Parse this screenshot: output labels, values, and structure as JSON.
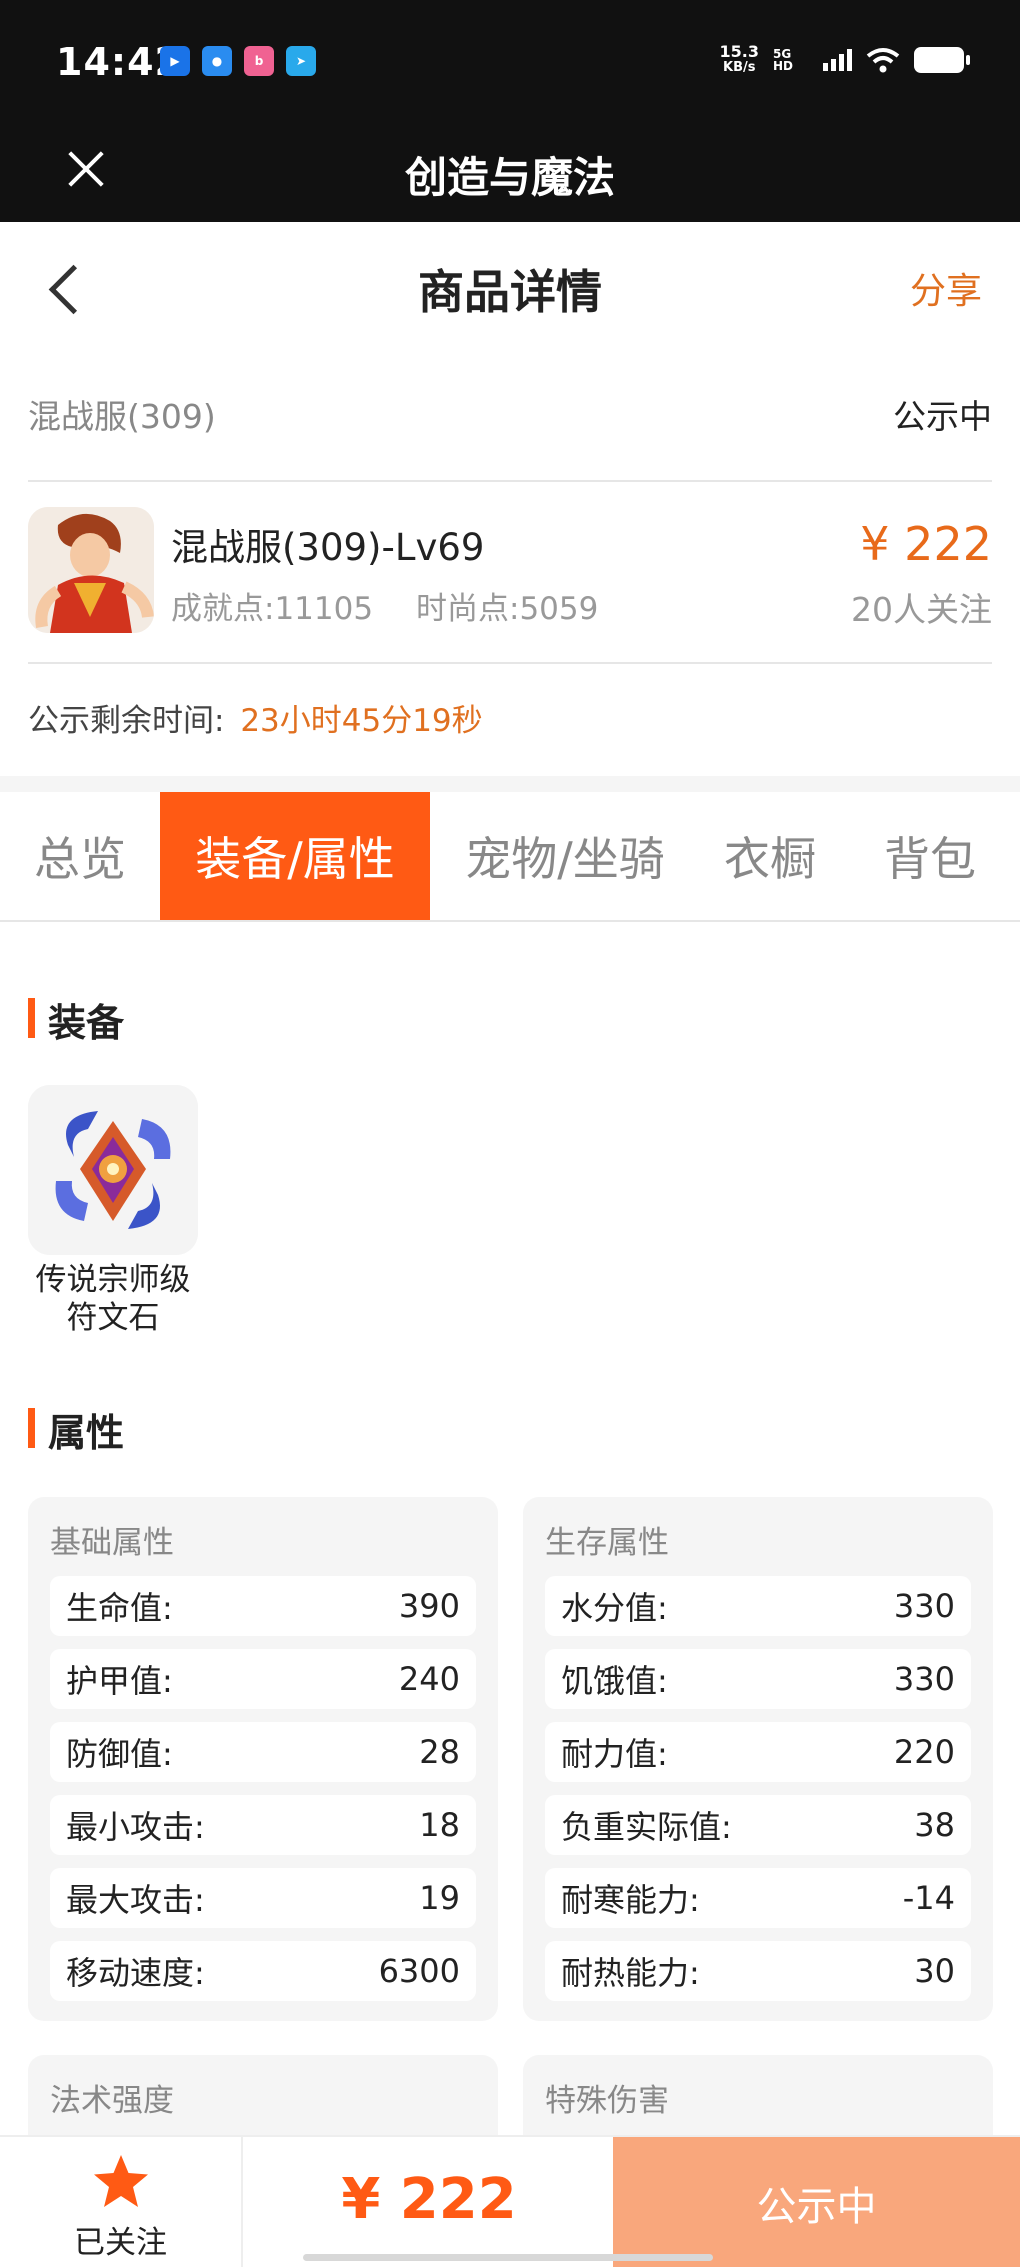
{
  "status_bar": {
    "time": "14:42",
    "net_speed": "15.3",
    "net_unit": "KB/s",
    "net_type": "5G HD",
    "icons": [
      "location-app-icon",
      "browser-app-icon",
      "bilibili-app-icon",
      "telegram-app-icon",
      "wifi-icon",
      "battery-icon"
    ]
  },
  "app_bar": {
    "title": "创造与魔法",
    "close_icon": "close-icon"
  },
  "header": {
    "title": "商品详情",
    "share": "分享",
    "back_icon": "chevron-left-icon"
  },
  "server": {
    "name": "混战服(309)",
    "status": "公示中"
  },
  "item": {
    "title": "混战服(309)-Lv69",
    "achievement": "成就点:11105",
    "fashion": "时尚点:5059",
    "price": "¥ 222",
    "watchers": "20人关注"
  },
  "countdown": {
    "label": "公示剩余时间:",
    "value": "23小时45分19秒"
  },
  "tabs": [
    {
      "label": "总览",
      "active": false
    },
    {
      "label": "装备/属性",
      "active": true
    },
    {
      "label": "宠物/坐骑",
      "active": false
    },
    {
      "label": "衣橱",
      "active": false
    },
    {
      "label": "背包",
      "active": false
    }
  ],
  "equipment": {
    "heading": "装备",
    "items": [
      {
        "name_line1": "传说宗师级",
        "name_line2": "符文石"
      }
    ]
  },
  "attributes": {
    "heading": "属性",
    "basic": {
      "title": "基础属性",
      "rows": [
        {
          "label": "生命值:",
          "value": "390"
        },
        {
          "label": "护甲值:",
          "value": "240"
        },
        {
          "label": "防御值:",
          "value": "28"
        },
        {
          "label": "最小攻击:",
          "value": "18"
        },
        {
          "label": "最大攻击:",
          "value": "19"
        },
        {
          "label": "移动速度:",
          "value": "6300"
        }
      ]
    },
    "survival": {
      "title": "生存属性",
      "rows": [
        {
          "label": "水分值:",
          "value": "330"
        },
        {
          "label": "饥饿值:",
          "value": "330"
        },
        {
          "label": "耐力值:",
          "value": "220"
        },
        {
          "label": "负重实际值:",
          "value": "38"
        },
        {
          "label": "耐寒能力:",
          "value": "-14"
        },
        {
          "label": "耐热能力:",
          "value": "30"
        }
      ]
    },
    "magic": {
      "title": "法术强度"
    },
    "special": {
      "title": "特殊伤害"
    }
  },
  "bottom_bar": {
    "follow_label": "已关注",
    "price": "¥ 222",
    "status_button": "公示中"
  },
  "colors": {
    "accent": "#ff5a14",
    "price": "#e86a1a",
    "status_button": "#f9a77c"
  }
}
